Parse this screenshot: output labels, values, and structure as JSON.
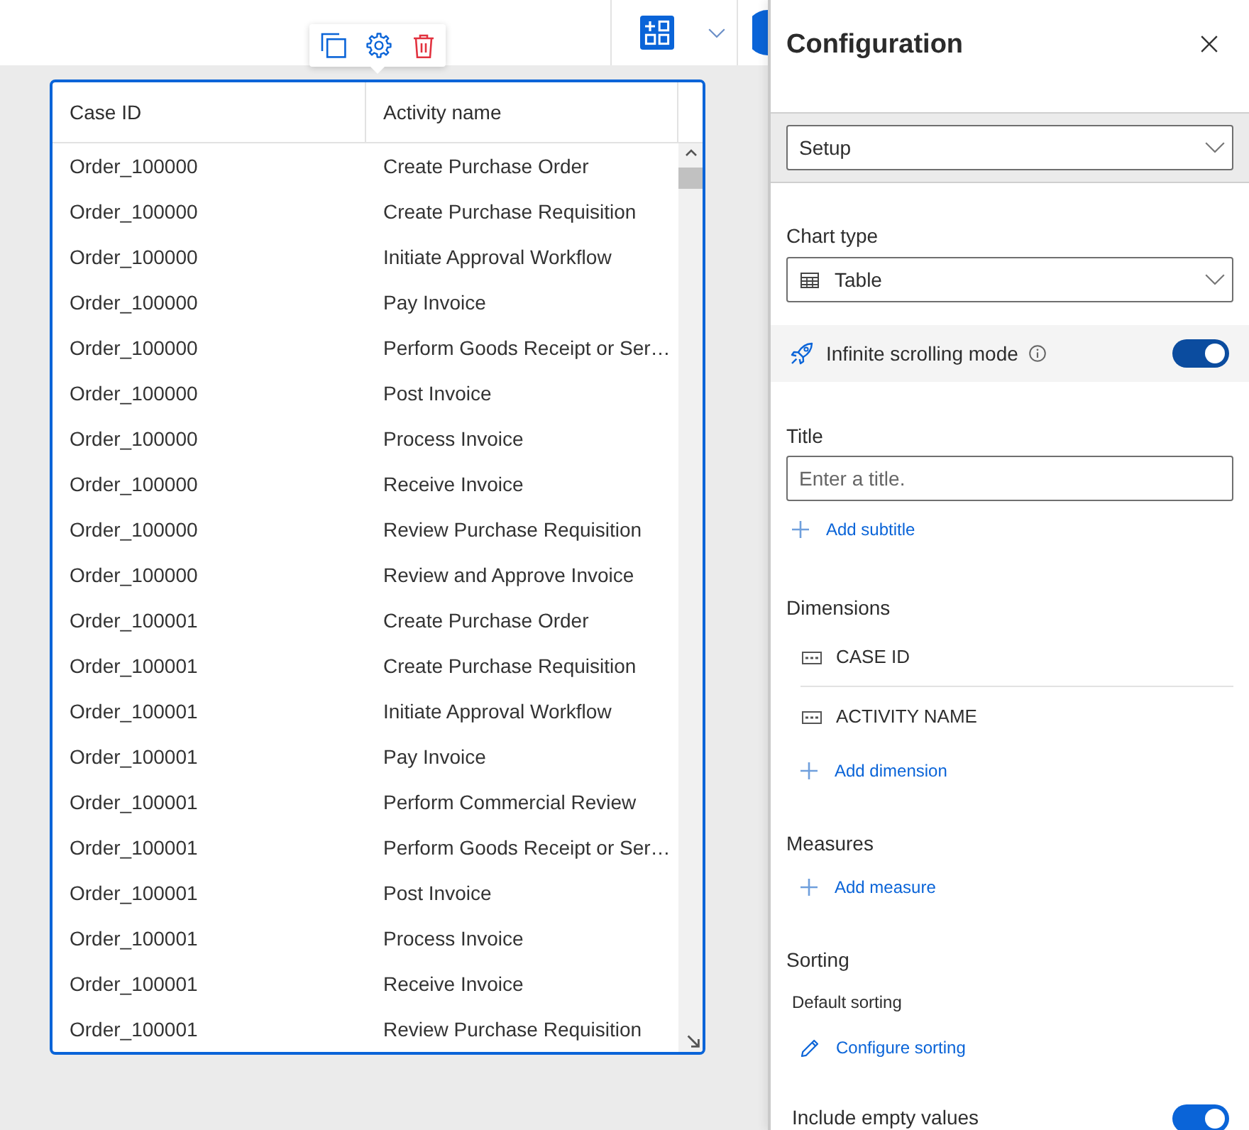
{
  "table": {
    "columns": [
      "Case ID",
      "Activity name"
    ],
    "rows": [
      [
        "Order_100000",
        "Create Purchase Order"
      ],
      [
        "Order_100000",
        "Create Purchase Requisition"
      ],
      [
        "Order_100000",
        "Initiate Approval Workflow"
      ],
      [
        "Order_100000",
        "Pay Invoice"
      ],
      [
        "Order_100000",
        "Perform Goods Receipt or Ser…"
      ],
      [
        "Order_100000",
        "Post Invoice"
      ],
      [
        "Order_100000",
        "Process Invoice"
      ],
      [
        "Order_100000",
        "Receive Invoice"
      ],
      [
        "Order_100000",
        "Review Purchase Requisition"
      ],
      [
        "Order_100000",
        "Review and Approve Invoice"
      ],
      [
        "Order_100001",
        "Create Purchase Order"
      ],
      [
        "Order_100001",
        "Create Purchase Requisition"
      ],
      [
        "Order_100001",
        "Initiate Approval Workflow"
      ],
      [
        "Order_100001",
        "Pay Invoice"
      ],
      [
        "Order_100001",
        "Perform Commercial Review"
      ],
      [
        "Order_100001",
        "Perform Goods Receipt or Ser…"
      ],
      [
        "Order_100001",
        "Post Invoice"
      ],
      [
        "Order_100001",
        "Process Invoice"
      ],
      [
        "Order_100001",
        "Receive Invoice"
      ],
      [
        "Order_100001",
        "Review Purchase Requisition"
      ]
    ]
  },
  "panel": {
    "title": "Configuration",
    "view_select": {
      "value": "Setup"
    },
    "chart_type": {
      "label": "Chart type",
      "value": "Table"
    },
    "infinite_scrolling": {
      "label": "Infinite scrolling mode",
      "on": true
    },
    "title_field": {
      "label": "Title",
      "placeholder": "Enter a title.",
      "add_link": "Add subtitle"
    },
    "dimensions": {
      "label": "Dimensions",
      "items": [
        "CASE ID",
        "ACTIVITY NAME"
      ],
      "add_link": "Add dimension"
    },
    "measures": {
      "label": "Measures",
      "add_link": "Add measure"
    },
    "sorting": {
      "label": "Sorting",
      "summary": "Default sorting",
      "link": "Configure sorting"
    },
    "include_empty": {
      "label": "Include empty values",
      "on": true
    }
  }
}
